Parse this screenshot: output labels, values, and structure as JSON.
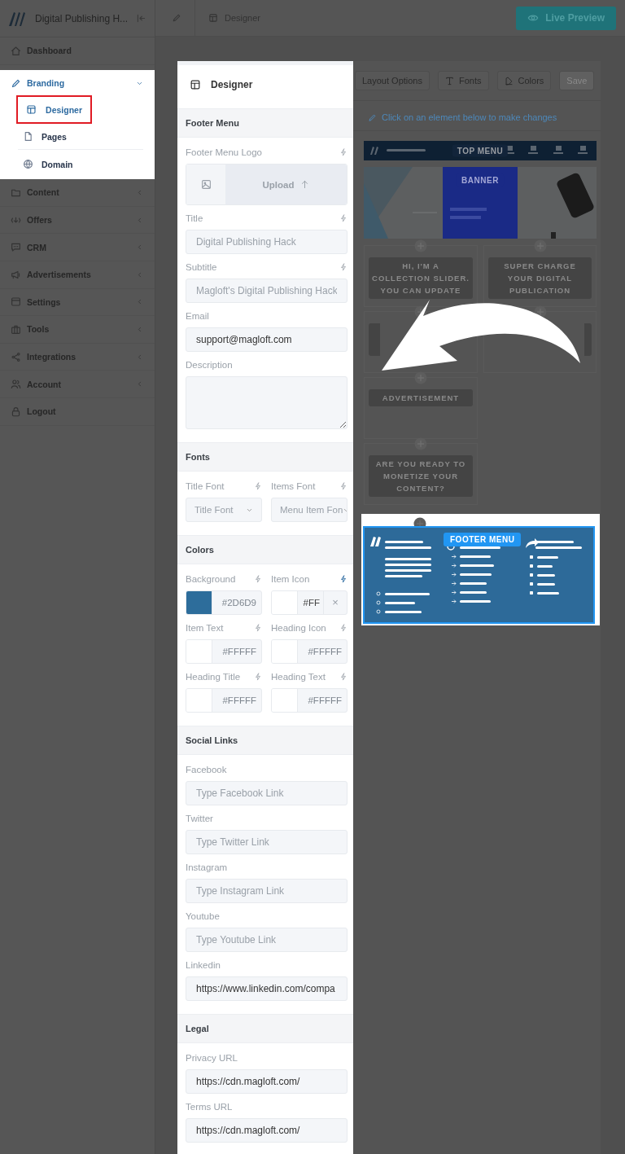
{
  "app": {
    "title": "Digital Publishing H..."
  },
  "breadcrumb": {
    "current": "Designer"
  },
  "live_preview": {
    "label": "Live Preview"
  },
  "sidebar": {
    "items": [
      {
        "label": "Dashboard"
      },
      {
        "label": "Branding",
        "expanded": true,
        "spotlight": true,
        "children": [
          {
            "label": "Designer",
            "selected": true
          },
          {
            "label": "Pages",
            "selected": false
          },
          {
            "label": "Domain",
            "selected": false
          }
        ]
      },
      {
        "label": "Content",
        "expanded": false
      },
      {
        "label": "Offers",
        "expanded": false
      },
      {
        "label": "CRM",
        "expanded": false
      },
      {
        "label": "Advertisements",
        "expanded": false
      },
      {
        "label": "Settings",
        "expanded": false
      },
      {
        "label": "Tools",
        "expanded": false
      },
      {
        "label": "Integrations",
        "expanded": false
      },
      {
        "label": "Account",
        "expanded": false
      },
      {
        "label": "Logout"
      }
    ]
  },
  "designer": {
    "title": "Designer",
    "spotlight": true,
    "sections": [
      {
        "title": "Footer Menu",
        "fields": [
          {
            "kind": "upload",
            "label": "Footer Menu Logo",
            "bolt": false,
            "button": "Upload"
          },
          {
            "kind": "text",
            "label": "Title",
            "bolt": false,
            "placeholder": "Digital Publishing Hack"
          },
          {
            "kind": "text",
            "label": "Subtitle",
            "bolt": false,
            "placeholder": "Magloft's Digital Publishing Hack"
          },
          {
            "kind": "text",
            "label": "Email",
            "value": "support@magloft.com"
          },
          {
            "kind": "textarea",
            "label": "Description"
          }
        ]
      },
      {
        "title": "Fonts",
        "fields": [
          {
            "kind": "select",
            "label": "Title Font",
            "bolt": false,
            "placeholder": "Title Font"
          },
          {
            "kind": "select",
            "label": "Items Font",
            "bolt": false,
            "placeholder": "Menu Item Fon"
          }
        ]
      },
      {
        "title": "Colors",
        "fields": [
          {
            "kind": "color",
            "label": "Background",
            "bolt": false,
            "color": "#2d6d9b",
            "value": "#2D6D9"
          },
          {
            "kind": "color",
            "label": "Item Icon",
            "bolt": true,
            "color": "#ffffff",
            "value": "#FF",
            "clear": "×"
          },
          {
            "kind": "color",
            "label": "Item Text",
            "bolt": false,
            "color": "#ffffff",
            "value": "#FFFFF"
          },
          {
            "kind": "color",
            "label": "Heading Icon",
            "bolt": false,
            "color": "#ffffff",
            "value": "#FFFFF"
          },
          {
            "kind": "color",
            "label": "Heading Title",
            "bolt": false,
            "color": "#ffffff",
            "value": "#FFFFF"
          },
          {
            "kind": "color",
            "label": "Heading Text",
            "bolt": false,
            "color": "#ffffff",
            "value": "#FFFFF"
          }
        ]
      },
      {
        "title": "Social Links",
        "fields": [
          {
            "kind": "text",
            "label": "Facebook",
            "placeholder": "Type Facebook Link"
          },
          {
            "kind": "text",
            "label": "Twitter",
            "placeholder": "Type Twitter Link"
          },
          {
            "kind": "text",
            "label": "Instagram",
            "placeholder": "Type Instagram Link"
          },
          {
            "kind": "text",
            "label": "Youtube",
            "placeholder": "Type Youtube Link"
          },
          {
            "kind": "text",
            "label": "Linkedin",
            "value": "https://www.linkedin.com/compa"
          }
        ]
      },
      {
        "title": "Legal",
        "fields": [
          {
            "kind": "text",
            "label": "Privacy URL",
            "value": "https://cdn.magloft.com/"
          },
          {
            "kind": "text",
            "label": "Terms URL",
            "value": "https://cdn.magloft.com/"
          }
        ]
      }
    ]
  },
  "preview": {
    "toolbar": [
      {
        "label": "Layout Options",
        "disabled": false
      },
      {
        "label": "Fonts",
        "disabled": false
      },
      {
        "label": "Colors",
        "disabled": false
      },
      {
        "label": "Save",
        "disabled": true
      }
    ],
    "hint": "Click on an element below to make changes",
    "top_menu": {
      "label": "TOP MENU"
    },
    "banner": {
      "label": "BANNER"
    },
    "left_blocks": [
      {
        "kind": "text",
        "lines": [
          "HI, I'M A",
          "COLLECTION SLIDER.",
          "YOU CAN UPDATE"
        ]
      },
      {
        "kind": "covered"
      },
      {
        "kind": "text",
        "lines": [
          "ADVERTISEMENT"
        ]
      },
      {
        "kind": "text",
        "lines": [
          "ARE YOU READY TO",
          "MONETIZE YOUR",
          "CONTENT?"
        ]
      }
    ],
    "right_blocks": [
      {
        "kind": "text",
        "lines": [
          "SUPER CHARGE",
          "YOUR DIGITAL",
          "PUBLICATION"
        ]
      },
      {
        "kind": "covered"
      }
    ],
    "footer": {
      "label": "FOOTER MENU",
      "spotlight": true
    }
  }
}
